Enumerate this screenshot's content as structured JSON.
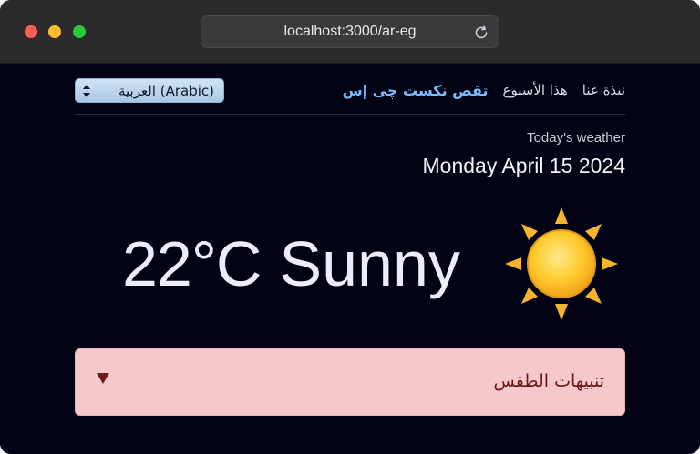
{
  "browser": {
    "url": "localhost:3000/ar-eg"
  },
  "nav": {
    "brand": "تقص نكست چى إس",
    "links": [
      "هذا الأسبوع",
      "نبذة عنا"
    ],
    "language_select": {
      "value": "العربية (Arabic)"
    }
  },
  "weather": {
    "subtitle": "Today's weather",
    "date": "Monday April 15 2024",
    "temperature": "22°C",
    "condition": "Sunny",
    "icon": "sun-icon"
  },
  "alerts": {
    "title": "تنبيهات الطقس",
    "expanded": false
  },
  "colors": {
    "page_bg": "#010314",
    "brand": "#7bbcff",
    "alert_bg": "#f5c9cb",
    "alert_text": "#6d1716"
  }
}
